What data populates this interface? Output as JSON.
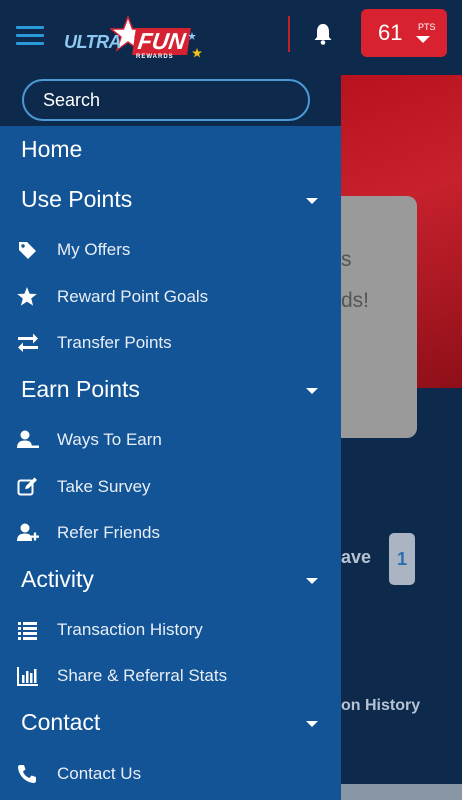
{
  "header": {
    "logo": {
      "ultra": "ULTRA",
      "fun": "FUN",
      "rewards": "REWARDS"
    },
    "points": {
      "value": "61",
      "label": "PTS"
    }
  },
  "search": {
    "placeholder": "Search"
  },
  "menu": {
    "home": "Home",
    "use_points": {
      "label": "Use Points",
      "items": [
        {
          "label": "My Offers",
          "icon": "tag-icon"
        },
        {
          "label": "Reward Point Goals",
          "icon": "star-icon"
        },
        {
          "label": "Transfer Points",
          "icon": "transfer-arrows-icon"
        }
      ]
    },
    "earn_points": {
      "label": "Earn Points",
      "items": [
        {
          "label": "Ways To Earn",
          "icon": "user-line-icon"
        },
        {
          "label": "Take Survey",
          "icon": "edit-icon"
        },
        {
          "label": "Refer Friends",
          "icon": "user-plus-icon"
        }
      ]
    },
    "activity": {
      "label": "Activity",
      "items": [
        {
          "label": "Transaction History",
          "icon": "list-icon"
        },
        {
          "label": "Share & Referral Stats",
          "icon": "bar-chart-icon"
        }
      ]
    },
    "contact": {
      "label": "Contact",
      "items": [
        {
          "label": "Contact Us",
          "icon": "phone-icon"
        }
      ]
    }
  },
  "background": {
    "card_line1": "s",
    "card_line2": "ds!",
    "save_text": "ave",
    "page_number": "1",
    "history_text": "on History"
  },
  "colors": {
    "header_bg": "#0d2a4d",
    "drawer_bg": "#125496",
    "accent_red": "#d9222f",
    "accent_blue": "#2a9ad9"
  }
}
